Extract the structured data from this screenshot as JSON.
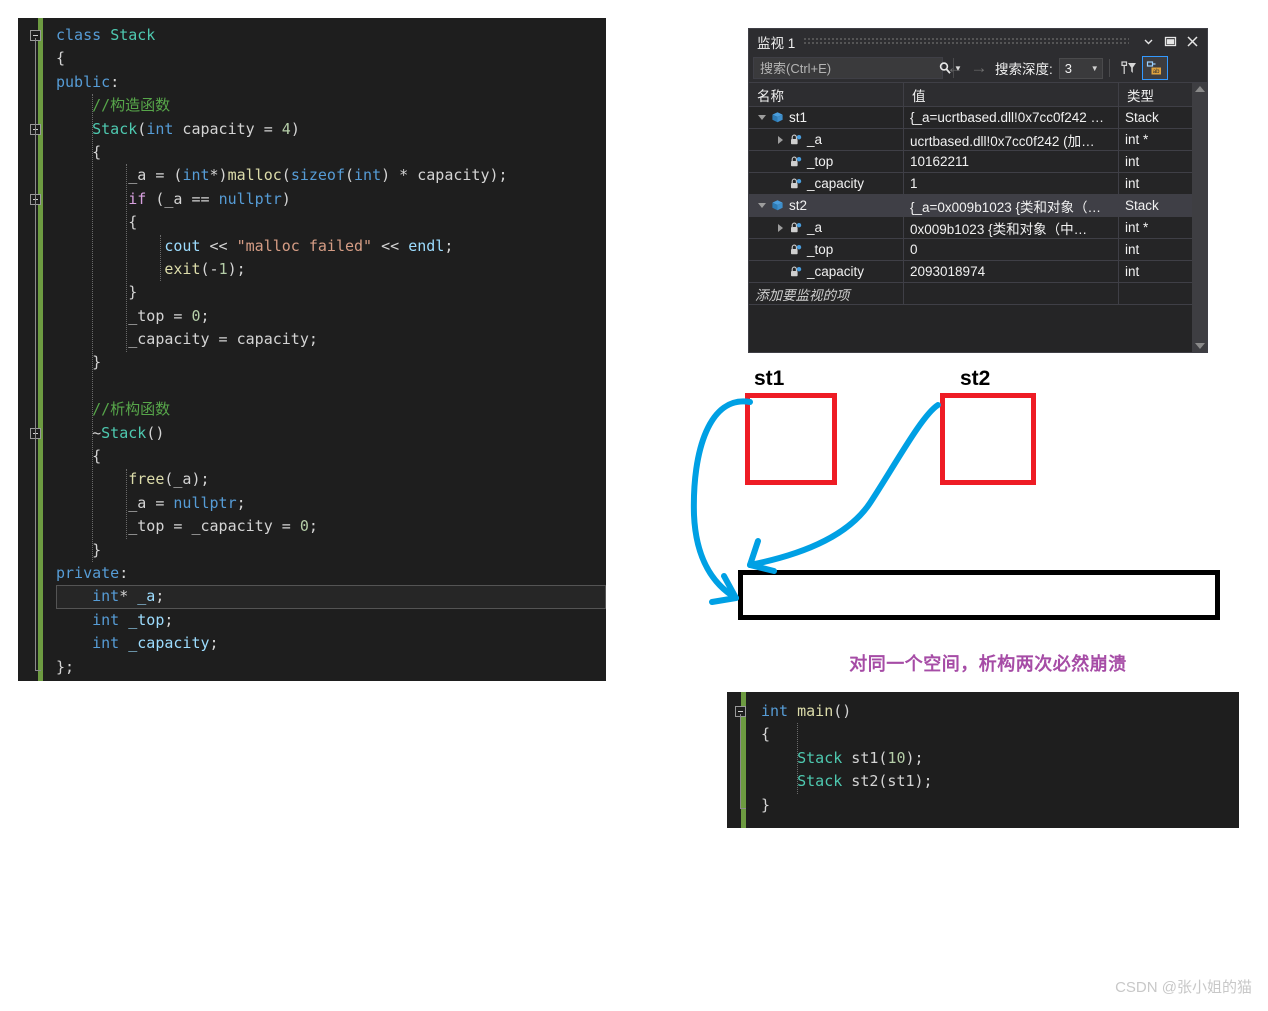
{
  "editor": {
    "main_code_lines": [
      [
        {
          "t": "class ",
          "c": "k"
        },
        {
          "t": "Stack",
          "c": "ty"
        }
      ],
      [
        {
          "t": "{",
          "c": "pl"
        }
      ],
      [
        {
          "t": "public",
          "c": "k"
        },
        {
          "t": ":",
          "c": "pl"
        }
      ],
      [
        {
          "t": "    ",
          "c": "pl"
        },
        {
          "t": "//构造函数",
          "c": "cm"
        }
      ],
      [
        {
          "t": "    ",
          "c": "pl"
        },
        {
          "t": "Stack",
          "c": "ty"
        },
        {
          "t": "(",
          "c": "pl"
        },
        {
          "t": "int",
          "c": "k"
        },
        {
          "t": " capacity = ",
          "c": "pl"
        },
        {
          "t": "4",
          "c": "nm"
        },
        {
          "t": ")",
          "c": "pl"
        }
      ],
      [
        {
          "t": "    {",
          "c": "pl"
        }
      ],
      [
        {
          "t": "        _a = (",
          "c": "pl"
        },
        {
          "t": "int",
          "c": "k"
        },
        {
          "t": "*)",
          "c": "pl"
        },
        {
          "t": "malloc",
          "c": "fn"
        },
        {
          "t": "(",
          "c": "pl"
        },
        {
          "t": "sizeof",
          "c": "k"
        },
        {
          "t": "(",
          "c": "pl"
        },
        {
          "t": "int",
          "c": "k"
        },
        {
          "t": ") * capacity);",
          "c": "pl"
        }
      ],
      [
        {
          "t": "        ",
          "c": "pl"
        },
        {
          "t": "if",
          "c": "kp"
        },
        {
          "t": " (_a == ",
          "c": "pl"
        },
        {
          "t": "nullptr",
          "c": "k"
        },
        {
          "t": ")",
          "c": "pl"
        }
      ],
      [
        {
          "t": "        {",
          "c": "pl"
        }
      ],
      [
        {
          "t": "            ",
          "c": "pl"
        },
        {
          "t": "cout",
          "c": "id"
        },
        {
          "t": " << ",
          "c": "pl"
        },
        {
          "t": "\"malloc failed\"",
          "c": "st"
        },
        {
          "t": " << ",
          "c": "pl"
        },
        {
          "t": "endl",
          "c": "id"
        },
        {
          "t": ";",
          "c": "pl"
        }
      ],
      [
        {
          "t": "            ",
          "c": "pl"
        },
        {
          "t": "exit",
          "c": "fn"
        },
        {
          "t": "(-",
          "c": "pl"
        },
        {
          "t": "1",
          "c": "nm"
        },
        {
          "t": ");",
          "c": "pl"
        }
      ],
      [
        {
          "t": "        }",
          "c": "pl"
        }
      ],
      [
        {
          "t": "        _top = ",
          "c": "pl"
        },
        {
          "t": "0",
          "c": "nm"
        },
        {
          "t": ";",
          "c": "pl"
        }
      ],
      [
        {
          "t": "        _capacity = capacity;",
          "c": "pl"
        }
      ],
      [
        {
          "t": "    }",
          "c": "pl"
        }
      ],
      [
        {
          "t": "",
          "c": "pl"
        }
      ],
      [
        {
          "t": "    ",
          "c": "pl"
        },
        {
          "t": "//析构函数",
          "c": "cm"
        }
      ],
      [
        {
          "t": "    ~",
          "c": "pl"
        },
        {
          "t": "Stack",
          "c": "ty"
        },
        {
          "t": "()",
          "c": "pl"
        }
      ],
      [
        {
          "t": "    {",
          "c": "pl"
        }
      ],
      [
        {
          "t": "        ",
          "c": "pl"
        },
        {
          "t": "free",
          "c": "fn"
        },
        {
          "t": "(_a);",
          "c": "pl"
        }
      ],
      [
        {
          "t": "        _a = ",
          "c": "pl"
        },
        {
          "t": "nullptr",
          "c": "k"
        },
        {
          "t": ";",
          "c": "pl"
        }
      ],
      [
        {
          "t": "        _top = _capacity = ",
          "c": "pl"
        },
        {
          "t": "0",
          "c": "nm"
        },
        {
          "t": ";",
          "c": "pl"
        }
      ],
      [
        {
          "t": "    }",
          "c": "pl"
        }
      ],
      [
        {
          "t": "private",
          "c": "k"
        },
        {
          "t": ":",
          "c": "pl"
        }
      ],
      [
        {
          "t": "    ",
          "c": "pl"
        },
        {
          "t": "int",
          "c": "k"
        },
        {
          "t": "* ",
          "c": "pl"
        },
        {
          "t": "_a",
          "c": "id"
        },
        {
          "t": ";",
          "c": "pl"
        }
      ],
      [
        {
          "t": "    ",
          "c": "pl"
        },
        {
          "t": "int",
          "c": "k"
        },
        {
          "t": " ",
          "c": "pl"
        },
        {
          "t": "_top",
          "c": "id"
        },
        {
          "t": ";",
          "c": "pl"
        }
      ],
      [
        {
          "t": "    ",
          "c": "pl"
        },
        {
          "t": "int",
          "c": "k"
        },
        {
          "t": " ",
          "c": "pl"
        },
        {
          "t": "_capacity",
          "c": "id"
        },
        {
          "t": ";",
          "c": "pl"
        }
      ],
      [
        {
          "t": "};",
          "c": "pl"
        }
      ]
    ],
    "main_selected_line_index": 24,
    "second_code_lines": [
      [
        {
          "t": "int",
          "c": "k"
        },
        {
          "t": " ",
          "c": "pl"
        },
        {
          "t": "main",
          "c": "fn"
        },
        {
          "t": "()",
          "c": "pl"
        }
      ],
      [
        {
          "t": "{",
          "c": "pl"
        }
      ],
      [
        {
          "t": "    ",
          "c": "pl"
        },
        {
          "t": "Stack",
          "c": "ty"
        },
        {
          "t": " st1(",
          "c": "pl"
        },
        {
          "t": "10",
          "c": "nm"
        },
        {
          "t": ");",
          "c": "pl"
        }
      ],
      [
        {
          "t": "    ",
          "c": "pl"
        },
        {
          "t": "Stack",
          "c": "ty"
        },
        {
          "t": " st2(st1);",
          "c": "pl"
        }
      ],
      [
        {
          "t": "}",
          "c": "pl"
        }
      ]
    ]
  },
  "watch": {
    "title": "监视 1",
    "window_buttons": {
      "dropdown": "chevron-down",
      "maximize": "maximize",
      "close": "close"
    },
    "toolbar": {
      "search_placeholder": "搜索(Ctrl+E)",
      "search_value": "",
      "depth_label": "搜索深度:",
      "depth_value": "3",
      "back_arrow": "←",
      "forward_arrow": "→"
    },
    "columns": [
      "名称",
      "值",
      "类型"
    ],
    "rows": [
      {
        "indent": 0,
        "expander": "down",
        "icon": "object",
        "name": "st1",
        "value": "{_a=ucrtbased.dll!0x7cc0f242 …",
        "type": "Stack",
        "selected": false
      },
      {
        "indent": 1,
        "expander": "right",
        "icon": "field",
        "name": "_a",
        "value": "ucrtbased.dll!0x7cc0f242 (加…",
        "type": "int *",
        "selected": false
      },
      {
        "indent": 1,
        "expander": "none",
        "icon": "field",
        "name": "_top",
        "value": "10162211",
        "type": "int",
        "selected": false
      },
      {
        "indent": 1,
        "expander": "none",
        "icon": "field",
        "name": "_capacity",
        "value": "1",
        "type": "int",
        "selected": false
      },
      {
        "indent": 0,
        "expander": "down",
        "icon": "object",
        "name": "st2",
        "value": "{_a=0x009b1023 {类和对象（…",
        "type": "Stack",
        "selected": true
      },
      {
        "indent": 1,
        "expander": "right",
        "icon": "field",
        "name": "_a",
        "value": "0x009b1023 {类和对象（中…",
        "type": "int *",
        "selected": false
      },
      {
        "indent": 1,
        "expander": "none",
        "icon": "field",
        "name": "_top",
        "value": "0",
        "type": "int",
        "selected": false
      },
      {
        "indent": 1,
        "expander": "none",
        "icon": "field",
        "name": "_capacity",
        "value": "2093018974",
        "type": "int",
        "selected": false
      }
    ],
    "add_row_placeholder": "添加要监视的项"
  },
  "diagram": {
    "label_st1": "st1",
    "label_st2": "st2",
    "note": "对同一个空间，析构两次必然崩溃",
    "colors": {
      "box_red": "#ee1c25",
      "box_black": "#000000",
      "arrow_blue": "#00a0e4",
      "note_purple": "#a64ca6"
    }
  },
  "watermark": "CSDN @张小姐的猫"
}
